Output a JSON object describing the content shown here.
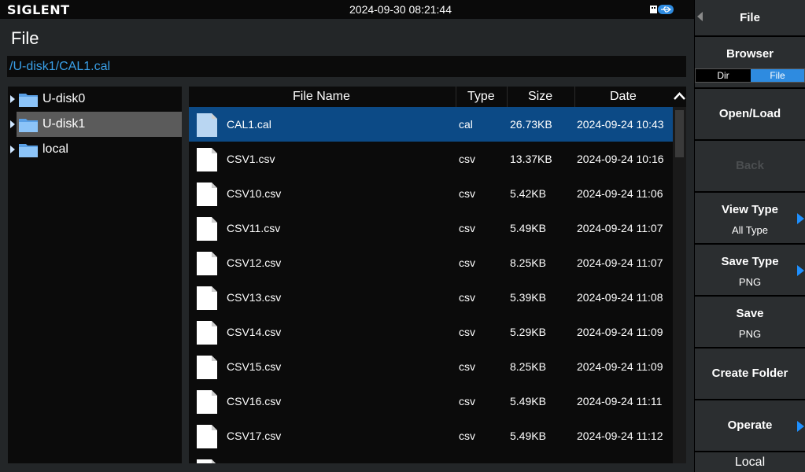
{
  "app": {
    "brand": "SIGLENT",
    "datetime": "2024-09-30 08:21:44"
  },
  "page": {
    "title": "File",
    "path": "/U-disk1/CAL1.cal"
  },
  "tree": [
    {
      "label": "U-disk0"
    },
    {
      "label": "U-disk1",
      "selected": true
    },
    {
      "label": "local"
    }
  ],
  "table": {
    "headers": {
      "name": "File Name",
      "type": "Type",
      "size": "Size",
      "date": "Date"
    },
    "rows": [
      {
        "name": "CAL1.cal",
        "type": "cal",
        "size": "26.73KB",
        "date": "2024-09-24 10:43",
        "selected": true
      },
      {
        "name": "CSV1.csv",
        "type": "csv",
        "size": "13.37KB",
        "date": "2024-09-24 10:16"
      },
      {
        "name": "CSV10.csv",
        "type": "csv",
        "size": "5.42KB",
        "date": "2024-09-24 11:06"
      },
      {
        "name": "CSV11.csv",
        "type": "csv",
        "size": "5.49KB",
        "date": "2024-09-24 11:07"
      },
      {
        "name": "CSV12.csv",
        "type": "csv",
        "size": "8.25KB",
        "date": "2024-09-24 11:07"
      },
      {
        "name": "CSV13.csv",
        "type": "csv",
        "size": "5.39KB",
        "date": "2024-09-24 11:08"
      },
      {
        "name": "CSV14.csv",
        "type": "csv",
        "size": "5.29KB",
        "date": "2024-09-24 11:09"
      },
      {
        "name": "CSV15.csv",
        "type": "csv",
        "size": "8.25KB",
        "date": "2024-09-24 11:09"
      },
      {
        "name": "CSV16.csv",
        "type": "csv",
        "size": "5.49KB",
        "date": "2024-09-24 11:11"
      },
      {
        "name": "CSV17.csv",
        "type": "csv",
        "size": "5.49KB",
        "date": "2024-09-24 11:12"
      }
    ]
  },
  "menu": {
    "title": "File",
    "browser": {
      "label": "Browser",
      "dir": "Dir",
      "file": "File",
      "active": "File"
    },
    "open_load": "Open/Load",
    "back": "Back",
    "view_type": {
      "label": "View Type",
      "value": "All Type"
    },
    "save_type": {
      "label": "Save Type",
      "value": "PNG"
    },
    "save": {
      "label": "Save",
      "value": "PNG"
    },
    "create_folder": "Create Folder",
    "operate": "Operate",
    "local": "Local"
  },
  "colors": {
    "accent": "#1e90ff",
    "selection": "#0c4a86",
    "path": "#3aa0e8"
  },
  "icons": {
    "usb": "usb-icon",
    "folder": "folder-icon",
    "file": "file-icon",
    "expand": "triangle-right-icon",
    "scroll_up": "chevron-up-icon"
  }
}
